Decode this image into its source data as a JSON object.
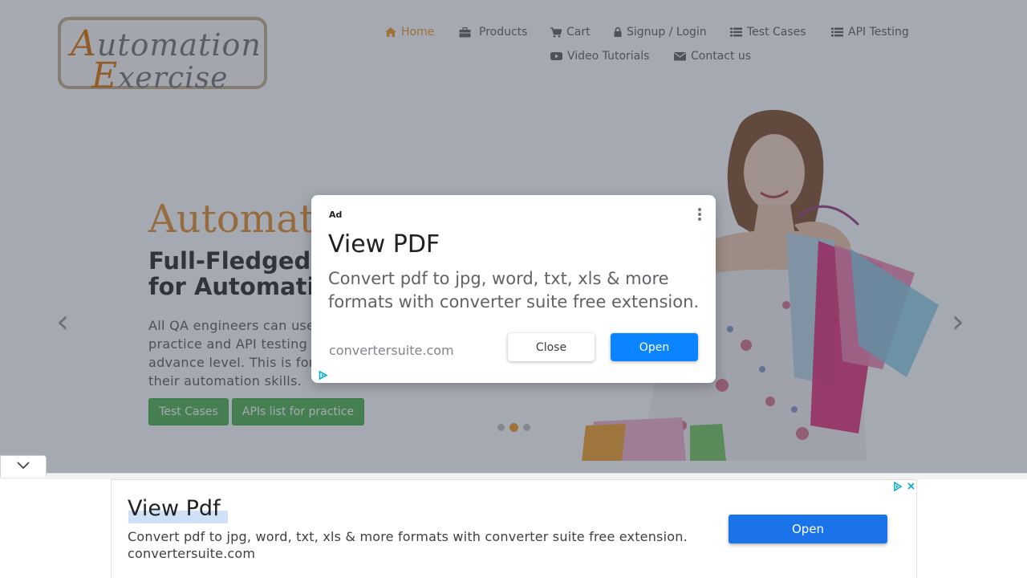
{
  "logo": {
    "cap1": "A",
    "rest1": "utomation",
    "cap2": "E",
    "rest2": "xercise"
  },
  "nav": {
    "home": "Home",
    "products": "Products",
    "cart": "Cart",
    "signup": "Signup / Login",
    "test_cases": "Test Cases",
    "api_testing": "API Testing",
    "video": "Video Tutorials",
    "contact": "Contact us"
  },
  "hero": {
    "title": "Automat",
    "subtitle_line1": "Full-Fledged",
    "subtitle_line2": "for Automatic",
    "para_lines": [
      "All QA engineers can use",
      "practice and API testing e",
      "advance level. This is for",
      "their automation skills."
    ],
    "btn_test_cases": "Test Cases",
    "btn_apis": "APIs list for practice",
    "prev_arrow": "‹",
    "next_arrow": "›"
  },
  "carousel": {
    "slides": 3,
    "active": 2
  },
  "modal_ad": {
    "label": "Ad",
    "title": "View PDF",
    "description": "Convert pdf to jpg, word, txt, xls & more formats with converter suite free extension.",
    "url": "convertersuite.com",
    "close_label": "Close",
    "open_label": "Open"
  },
  "banner_ad": {
    "title": "View Pdf",
    "description": "Convert pdf to jpg, word, txt, xls & more formats with converter suite free extension.",
    "url": "convertersuite.com",
    "open_label": "Open"
  },
  "colors": {
    "accent": "#f3a130",
    "button_green": "#5cb85c",
    "ad_blue": "#1a73e8"
  }
}
